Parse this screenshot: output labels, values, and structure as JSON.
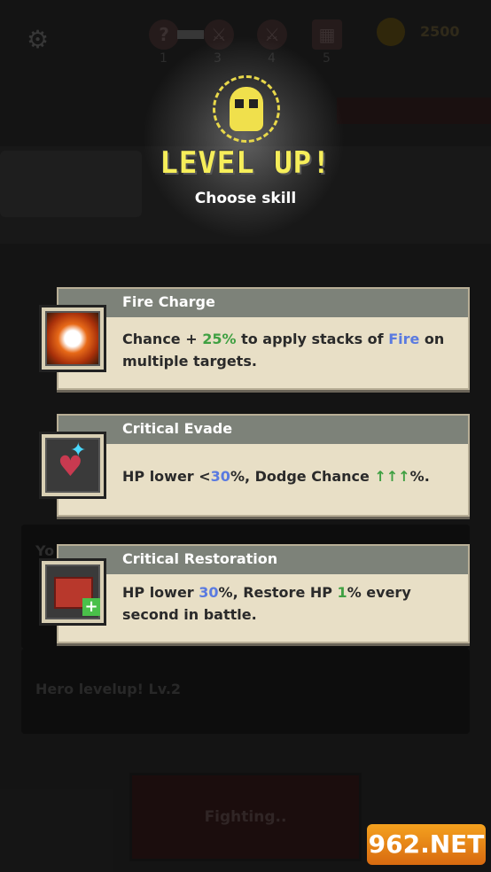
{
  "hud": {
    "slots": [
      {
        "num": "1",
        "icon": "question-icon"
      },
      {
        "num": "3",
        "icon": "sword-icon"
      },
      {
        "num": "4",
        "icon": "sword-icon"
      },
      {
        "num": "5",
        "icon": "puzzle-icon"
      }
    ],
    "coins": "2500"
  },
  "header": {
    "title": "LEVEL UP!",
    "subtitle": "Choose skill"
  },
  "skills": [
    {
      "name": "Fire Charge",
      "desc_parts": [
        "Chance + ",
        "25%",
        " to apply stacks of ",
        "Fire",
        " on multiple targets."
      ],
      "icon": "flaming-skull-icon"
    },
    {
      "name": "Critical Evade",
      "desc_parts": [
        "HP lower <",
        "30",
        "%, Dodge Chance ",
        "↑↑↑",
        "%."
      ],
      "icon": "broken-heart-icon"
    },
    {
      "name": "Critical Restoration",
      "desc_parts": [
        "HP lower ",
        "30",
        "%, Restore HP ",
        "1",
        "% every second in battle."
      ],
      "icon": "medkit-icon"
    }
  ],
  "log": {
    "partial": "Yo",
    "message": "Hero levelup! Lv.2"
  },
  "fight_button": "Fighting..",
  "watermark": "962.NET",
  "colors": {
    "accent_yellow": "#f6ee5a",
    "green": "#3fa042",
    "blue": "#5a7ae0",
    "card_bg": "#e8dfc6"
  }
}
